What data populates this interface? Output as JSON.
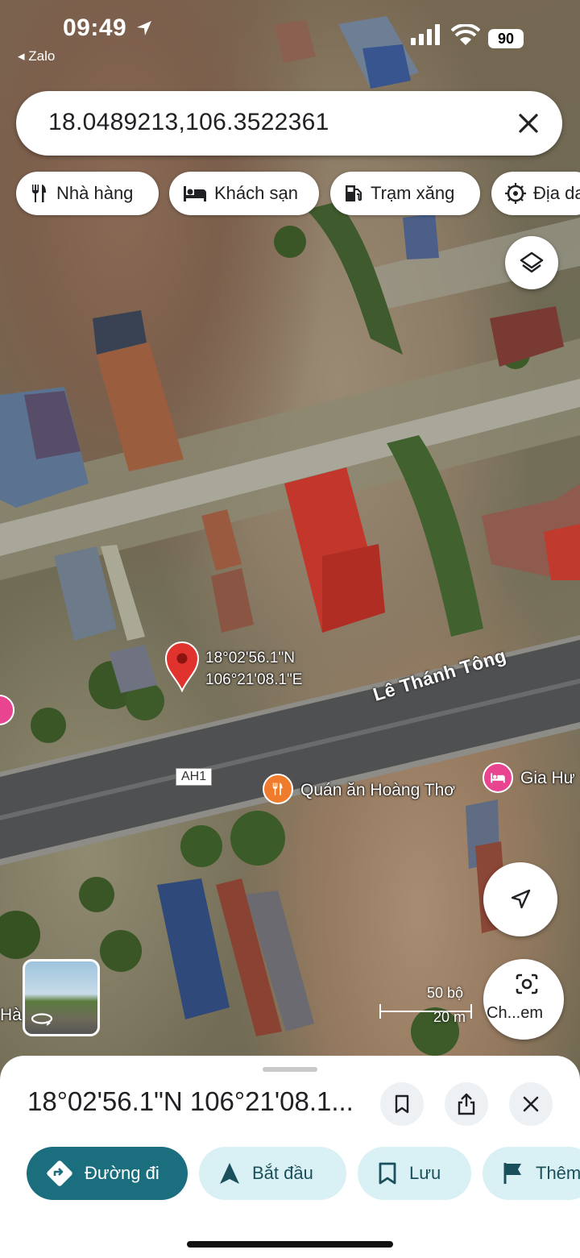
{
  "status_bar": {
    "time": "09:49",
    "back_app": "◂ Zalo",
    "battery": "90"
  },
  "search": {
    "query": "18.0489213,106.3522361"
  },
  "chips": [
    {
      "label": "Nhà hàng",
      "icon": "utensils-icon"
    },
    {
      "label": "Khách sạn",
      "icon": "bed-icon"
    },
    {
      "label": "Trạm xăng",
      "icon": "gas-pump-icon"
    },
    {
      "label": "Địa da",
      "icon": "landmark-icon"
    }
  ],
  "map": {
    "pin_lat": "18°02'56.1\"N",
    "pin_lng": "106°21'08.1\"E",
    "road_name": "Lê Thánh Tông",
    "highway_label": "AH1",
    "poi_restaurant": "Quán ăn Hoàng Thơ",
    "poi_hotel": "Gia Hư",
    "poi_left": "Hà",
    "scale_ft": "50 bộ",
    "scale_m": "20 m",
    "camera_label": "Ch...em"
  },
  "sheet": {
    "title": "18°02'56.1\"N 106°21'08.1...",
    "actions": [
      {
        "label": "Đường đi",
        "icon": "directions-icon"
      },
      {
        "label": "Bắt đầu",
        "icon": "navigation-arrow-icon"
      },
      {
        "label": "Lưu",
        "icon": "bookmark-icon"
      },
      {
        "label": "Thêm",
        "icon": "flag-icon"
      }
    ]
  },
  "colors": {
    "accent": "#1a6e7e",
    "action_bg": "#d9f0f4",
    "pin": "#e0332e",
    "restaurant": "#ef7b2c",
    "hotel": "#e9448f"
  }
}
